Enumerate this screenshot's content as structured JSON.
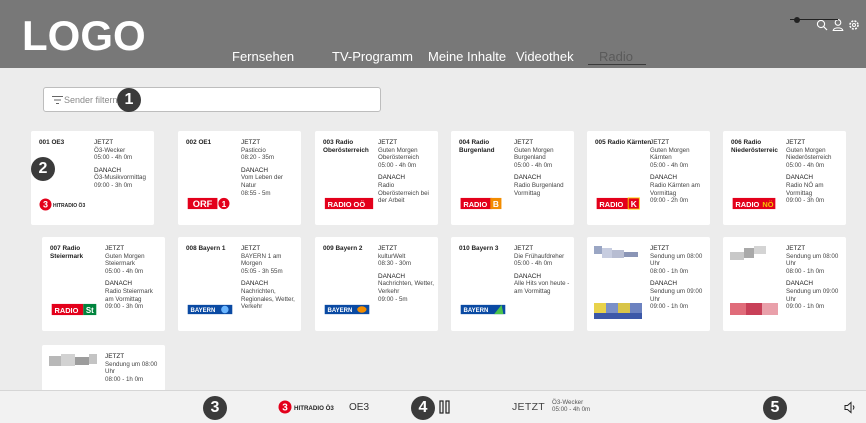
{
  "header": {
    "logo": "LOGO",
    "tabs": [
      {
        "label": "Fernsehen",
        "active": false
      },
      {
        "label": "TV-Programm",
        "active": false
      },
      {
        "label": "Meine Inhalte",
        "active": false
      },
      {
        "label": "Videothek",
        "active": false
      },
      {
        "label": "Radio",
        "active": true
      }
    ],
    "icons": [
      "search-icon",
      "user-icon",
      "settings-icon"
    ]
  },
  "filter": {
    "placeholder": "Sender filtern",
    "value": ""
  },
  "markers": [
    "1",
    "2",
    "3",
    "4",
    "5"
  ],
  "channels": [
    {
      "name": "001 OE3",
      "now_label": "JETZT",
      "now_show": "Ö3-Wecker",
      "now_time": "05:00 - 4h 0m",
      "next_label": "DANACH",
      "next_show": "Ö3-Musikvormittag",
      "next_time": "09:00 - 3h 0m",
      "logo": "HITRADIO Ö3"
    },
    {
      "name": "002 OE1",
      "now_label": "JETZT",
      "now_show": "Pasticcio",
      "now_time": "08:20 - 35m",
      "next_label": "DANACH",
      "next_show": "Vom Leben der Natur",
      "next_time": "08:55 - 5m",
      "logo": "ORF"
    },
    {
      "name": "003 Radio Oberösterreich",
      "now_label": "JETZT",
      "now_show": "Guten Morgen Oberösterreich",
      "now_time": "05:00 - 4h 0m",
      "next_label": "DANACH",
      "next_show": "Radio Oberösterreich bei der Arbeit",
      "next_time": "",
      "logo": "RADIO OÖ"
    },
    {
      "name": "004 Radio Burgenland",
      "now_label": "JETZT",
      "now_show": "Guten Morgen Burgenland",
      "now_time": "05:00 - 4h 0m",
      "next_label": "DANACH",
      "next_show": "Radio Burgenland Vormittag",
      "next_time": "",
      "logo": "RADIO B"
    },
    {
      "name": "005 Radio Kärnten",
      "now_label": "JETZT",
      "now_show": "Guten Morgen Kärnten",
      "now_time": "05:00 - 4h 0m",
      "next_label": "DANACH",
      "next_show": "Radio Kärnten am Vormittag",
      "next_time": "09:00 - 2h 0m",
      "logo": "RADIO K"
    },
    {
      "name": "006 Radio Niederösterreic",
      "now_label": "JETZT",
      "now_show": "Guten Morgen Niederösterreich",
      "now_time": "05:00 - 4h 0m",
      "next_label": "DANACH",
      "next_show": "Radio NÖ am Vormittag",
      "next_time": "09:00 - 3h 0m",
      "logo": "RADIO NÖ"
    },
    {
      "name": "007 Radio Steiermark",
      "now_label": "JETZT",
      "now_show": "Guten Morgen Steiermark",
      "now_time": "05:00 - 4h 0m",
      "next_label": "DANACH",
      "next_show": "Radio Steiermark am Vormittag",
      "next_time": "09:00 - 3h 0m",
      "logo": "RADIO St"
    },
    {
      "name": "008 Bayern 1",
      "now_label": "JETZT",
      "now_show": "BAYERN 1 am Morgen",
      "now_time": "05:05 - 3h 55m",
      "next_label": "DANACH",
      "next_show": "Nachrichten, Regionales, Wetter, Verkehr",
      "next_time": "",
      "logo": "BAYERN 1"
    },
    {
      "name": "009 Bayern 2",
      "now_label": "JETZT",
      "now_show": "kulturWelt",
      "now_time": "08:30 - 30m",
      "next_label": "DANACH",
      "next_show": "Nachrichten, Wetter, Verkehr",
      "next_time": "09:00 - 5m",
      "logo": "BAYERN 2"
    },
    {
      "name": "010 Bayern 3",
      "now_label": "JETZT",
      "now_show": "Die Frühaufdreher",
      "now_time": "05:00 - 4h 0m",
      "next_label": "DANACH",
      "next_show": "Alle Hits von heute - am Vormittag",
      "next_time": "",
      "logo": "BAYERN 3"
    },
    {
      "name": "",
      "now_label": "JETZT",
      "now_show": "Sendung um 08:00 Uhr",
      "now_time": "08:00 - 1h 0m",
      "next_label": "DANACH",
      "next_show": "Sendung um 09:00 Uhr",
      "next_time": "09:00 - 1h 0m",
      "logo": ""
    },
    {
      "name": "",
      "now_label": "JETZT",
      "now_show": "Sendung um 08:00 Uhr",
      "now_time": "08:00 - 1h 0m",
      "next_label": "DANACH",
      "next_show": "Sendung um 09:00 Uhr",
      "next_time": "09:00 - 1h 0m",
      "logo": ""
    },
    {
      "name": "",
      "now_label": "JETZT",
      "now_show": "Sendung um 08:00 Uhr",
      "now_time": "08:00 - 1h 0m",
      "next_label": "",
      "next_show": "",
      "next_time": "",
      "logo": ""
    }
  ],
  "player": {
    "logo": "HITRADIO Ö3",
    "name": "OE3",
    "now_label": "JETZT",
    "now_show": "Ö3-Wecker",
    "now_time": "05:00 - 4h 0m",
    "volume": 0.15
  },
  "colors": {
    "header_bg": "#787878",
    "page_bg": "#ececec",
    "orf_red": "#e3001b",
    "bayern_blue": "#0a4aa3",
    "burgenland_orange": "#f28c00",
    "noe_yellow": "#f5c400",
    "stmk_green": "#00843d"
  }
}
